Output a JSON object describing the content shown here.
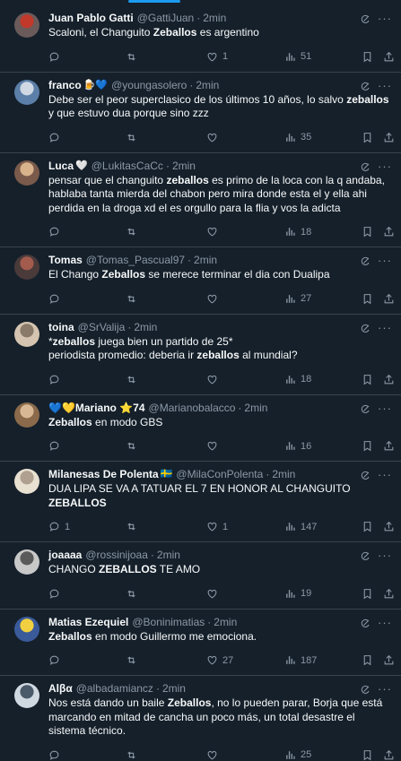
{
  "tweets": [
    {
      "name": "Juan Pablo Gatti",
      "emoji": "",
      "handle": "@GattiJuan",
      "time": "2min",
      "text": [
        {
          "t": "Scaloni, el Changuito "
        },
        {
          "t": "Zeballos",
          "b": true
        },
        {
          "t": " es argentino"
        }
      ],
      "replies": "",
      "retweets": "",
      "likes": "1",
      "views": "51",
      "avatar": [
        "#6a5a5a",
        "#c0392b"
      ]
    },
    {
      "name": "franco",
      "emoji": "🍺💙",
      "handle": "@youngasolero",
      "time": "2min",
      "text": [
        {
          "t": "Debe ser el peor superclasico de los últimos 10 años, lo salvo "
        },
        {
          "t": "zeballos",
          "b": true
        },
        {
          "t": " y que estuvo dua porque sino zzz"
        }
      ],
      "replies": "",
      "retweets": "",
      "likes": "",
      "views": "35",
      "avatar": [
        "#5b7fa8",
        "#cfd8e3"
      ]
    },
    {
      "name": "Luca",
      "emoji": "🤍",
      "handle": "@LukitasCaCc",
      "time": "2min",
      "text": [
        {
          "t": "pensar que el changuito "
        },
        {
          "t": "zeballos",
          "b": true
        },
        {
          "t": " es primo de la loca con la q andaba, hablaba tanta mierda del chabon pero mira donde esta el y ella ahi perdida en la droga xd el es orgullo para la flia y vos la adicta"
        }
      ],
      "replies": "",
      "retweets": "",
      "likes": "",
      "views": "18",
      "avatar": [
        "#7a5a4a",
        "#d9b38c"
      ]
    },
    {
      "name": "Tomas",
      "emoji": "",
      "handle": "@Tomas_Pascual97",
      "time": "2min",
      "text": [
        {
          "t": "El Chango "
        },
        {
          "t": "Zeballos",
          "b": true
        },
        {
          "t": " se merece terminar el dia con Dualipa"
        }
      ],
      "replies": "",
      "retweets": "",
      "likes": "",
      "views": "27",
      "avatar": [
        "#4a3a3a",
        "#a35b4e"
      ]
    },
    {
      "name": "toina",
      "emoji": "",
      "handle": "@SrValija",
      "time": "2min",
      "text": [
        {
          "t": "*"
        },
        {
          "t": "zeballos",
          "b": true
        },
        {
          "t": " juega bien un partido de 25*"
        },
        {
          "br": true
        },
        {
          "t": "periodista promedio: deberia ir "
        },
        {
          "t": "zeballos",
          "b": true
        },
        {
          "t": " al mundial?"
        }
      ],
      "replies": "",
      "retweets": "",
      "likes": "",
      "views": "18",
      "avatar": [
        "#d4c4b0",
        "#8a7a6a"
      ]
    },
    {
      "name": "💙💛Mariano ⭐74",
      "emoji": "",
      "handle": "@Marianobalacco",
      "time": "2min",
      "text": [
        {
          "t": "Zeballos",
          "b": true
        },
        {
          "t": " en modo GBS"
        }
      ],
      "replies": "",
      "retweets": "",
      "likes": "",
      "views": "16",
      "avatar": [
        "#8a6a4a",
        "#d8b894"
      ]
    },
    {
      "name": "Milanesas De Polenta",
      "emoji": "🇸🇪",
      "handle": "@MilaConPolenta",
      "time": "2min",
      "text": [
        {
          "t": "DUA LIPA SE VA A TATUAR EL 7 EN HONOR AL CHANGUITO "
        },
        {
          "t": "ZEBALLOS",
          "b": true
        }
      ],
      "replies": "1",
      "retweets": "",
      "likes": "1",
      "views": "147",
      "avatar": [
        "#e8e0d0",
        "#b0a090"
      ]
    },
    {
      "name": "joaaaa",
      "emoji": "",
      "handle": "@rossinijoaa",
      "time": "2min",
      "text": [
        {
          "t": "CHANGO "
        },
        {
          "t": "ZEBALLOS",
          "b": true
        },
        {
          "t": " TE AMO"
        }
      ],
      "replies": "",
      "retweets": "",
      "likes": "",
      "views": "19",
      "avatar": [
        "#c8c8c8",
        "#5a5a5a"
      ]
    },
    {
      "name": "Matias Ezequiel",
      "emoji": "",
      "handle": "@Boninimatias",
      "time": "2min",
      "text": [
        {
          "t": "Zeballos",
          "b": true
        },
        {
          "t": " en modo Guillermo me emociona."
        }
      ],
      "replies": "",
      "retweets": "",
      "likes": "27",
      "views": "187",
      "avatar": [
        "#3a5a9a",
        "#f0d040"
      ]
    },
    {
      "name": "Alβα",
      "emoji": "",
      "handle": "@albadamiancz",
      "time": "2min",
      "text": [
        {
          "t": "Nos está dando un baile "
        },
        {
          "t": "Zeballos",
          "b": true
        },
        {
          "t": ", no lo pueden parar, Borja que está marcando en mitad de cancha un poco más, un total desastre el sistema técnico."
        }
      ],
      "replies": "",
      "retweets": "",
      "likes": "",
      "views": "25",
      "avatar": [
        "#d0d8e0",
        "#4a5a6a"
      ]
    }
  ],
  "icons": {
    "reply": "reply-icon",
    "retweet": "retweet-icon",
    "like": "heart-icon",
    "views": "views-icon",
    "bookmark": "bookmark-icon",
    "share": "share-icon",
    "grok": "grok-icon",
    "more": "more-icon"
  },
  "colors": {
    "background": "#15202b",
    "muted": "#8b98a5",
    "accent": "#1d9bf0",
    "divider": "#38444d"
  }
}
